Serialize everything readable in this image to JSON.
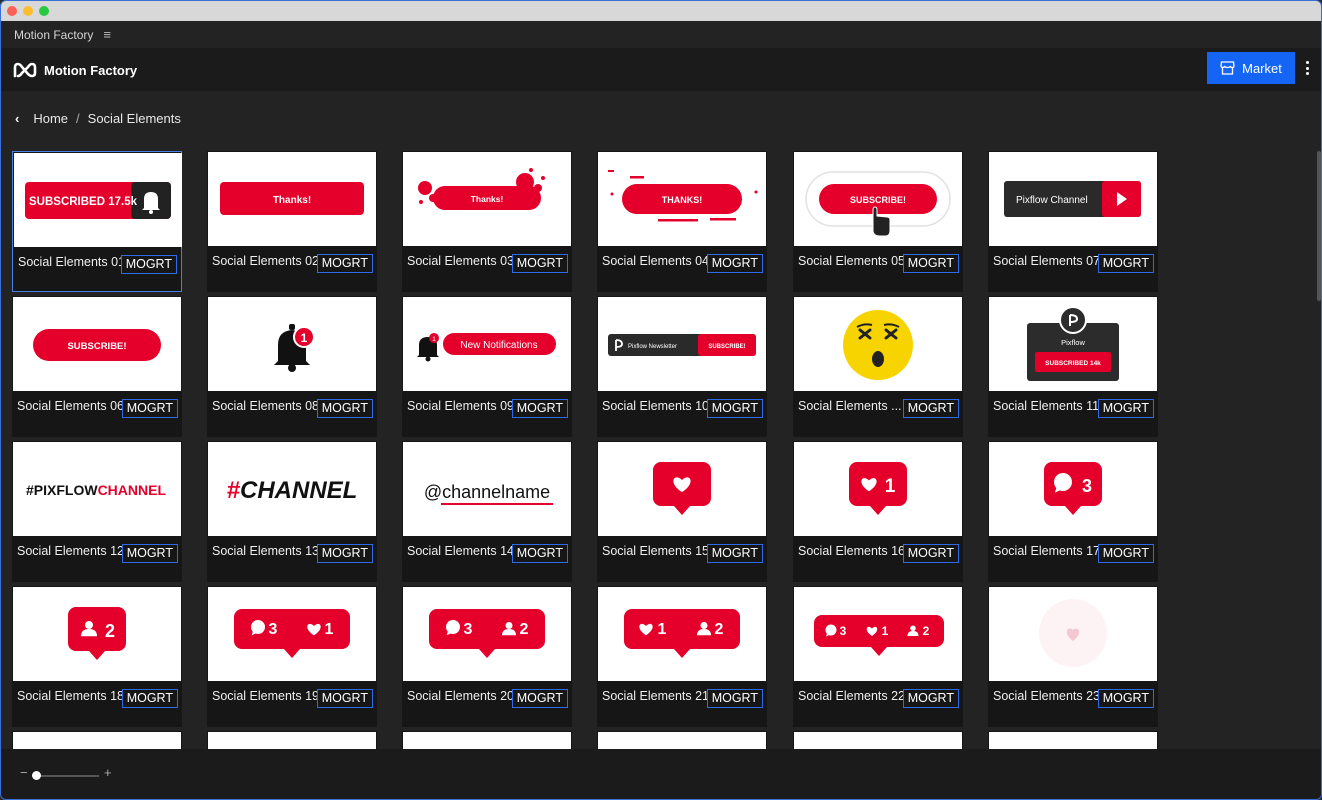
{
  "panel": {
    "title": "Motion Factory"
  },
  "header": {
    "brand": "Motion Factory",
    "market_label": "Market"
  },
  "breadcrumb": {
    "home": "Home",
    "sep": "/",
    "current": "Social Elements"
  },
  "badge_label": "MOGRT",
  "cards": [
    {
      "name": "Social Elements 01",
      "thumb": "subscribed-bell",
      "text": "SUBSCRIBED 17.5k"
    },
    {
      "name": "Social Elements 02",
      "thumb": "thanks",
      "text": "Thanks!"
    },
    {
      "name": "Social Elements 03",
      "thumb": "thanks-splash",
      "text": "Thanks!"
    },
    {
      "name": "Social Elements 04",
      "thumb": "thanks-caps",
      "text": "THANKS!"
    },
    {
      "name": "Social Elements 05",
      "thumb": "subscribe-cursor",
      "text": "SUBSCRIBE!"
    },
    {
      "name": "Social Elements 07",
      "thumb": "channel-play",
      "text": "Pixflow Channel"
    },
    {
      "name": "Social Elements 06",
      "thumb": "subscribe-pill",
      "text": "SUBSCRIBE!"
    },
    {
      "name": "Social Elements 08",
      "thumb": "bell-notif",
      "text": "1"
    },
    {
      "name": "Social Elements 09",
      "thumb": "new-notifications",
      "text": "New Notifications"
    },
    {
      "name": "Social Elements 10",
      "thumb": "newsletter",
      "text": "Pixflow Newsletter",
      "text2": "SUBSCRIBE!"
    },
    {
      "name": "Social Elements ...",
      "thumb": "emoji-face",
      "text": ""
    },
    {
      "name": "Social Elements 11",
      "thumb": "pixflow-card",
      "text": "Pixflow",
      "text2": "SUBSCRIBED 14k"
    },
    {
      "name": "Social Elements 12",
      "thumb": "hashtag-pixflow",
      "text": "#PIXFLOW",
      "text2": "CHANNEL"
    },
    {
      "name": "Social Elements 13",
      "thumb": "hashtag-channel",
      "text": "#CHANNEL"
    },
    {
      "name": "Social Elements 14",
      "thumb": "at-channelname",
      "text": "@channelname"
    },
    {
      "name": "Social Elements 15",
      "thumb": "heart-bubble",
      "text": ""
    },
    {
      "name": "Social Elements 16",
      "thumb": "heart-count",
      "text": "1"
    },
    {
      "name": "Social Elements 17",
      "thumb": "comment-count",
      "text": "3"
    },
    {
      "name": "Social Elements 18",
      "thumb": "user-count",
      "text": "2"
    },
    {
      "name": "Social Elements 19",
      "thumb": "comment-heart",
      "text": "3",
      "text2": "1"
    },
    {
      "name": "Social Elements 20",
      "thumb": "comment-user",
      "text": "3",
      "text2": "2"
    },
    {
      "name": "Social Elements 21",
      "thumb": "heart-user",
      "text": "1",
      "text2": "2"
    },
    {
      "name": "Social Elements 22",
      "thumb": "comment-heart-user",
      "text": "3",
      "text2": "1",
      "text3": "2"
    },
    {
      "name": "Social Elements 23",
      "thumb": "faint-heart",
      "text": ""
    }
  ],
  "colors": {
    "accent": "#e4002b",
    "market": "#1565f4",
    "badge_border": "#2f6be6"
  },
  "zoom": {
    "minus": "−",
    "plus": "+",
    "level": 0.05
  }
}
